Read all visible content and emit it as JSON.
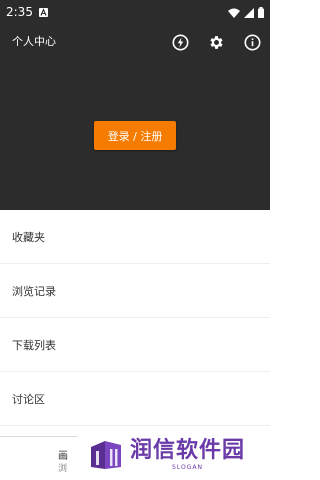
{
  "status_bar": {
    "time": "2:35",
    "icons": [
      "notification-a-icon",
      "wifi-icon",
      "signal-icon",
      "battery-icon"
    ]
  },
  "app_bar": {
    "title": "个人中心",
    "icons": [
      "flash-icon",
      "settings-gear-icon",
      "info-icon"
    ]
  },
  "hero": {
    "login_label": "登录 / 注册",
    "accent_color": "#f57c00",
    "background_color": "#2c2c2c"
  },
  "menu": {
    "items": [
      {
        "label": "收藏夹"
      },
      {
        "label": "浏览记录"
      },
      {
        "label": "下载列表"
      },
      {
        "label": "讨论区"
      }
    ]
  },
  "bottom_nav": {
    "partial_label": "画",
    "partial_sub": "浏"
  },
  "watermark": {
    "brand": "润信软件园",
    "slogan": "SLOGAN",
    "color": "#6a3aa8"
  }
}
